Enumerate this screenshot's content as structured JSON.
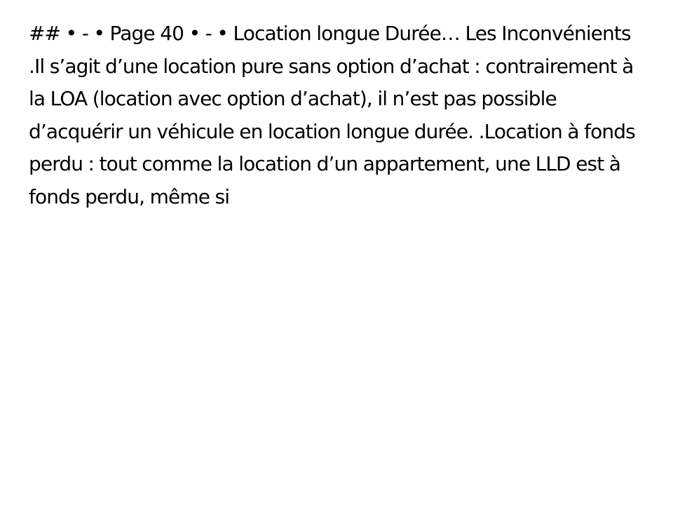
{
  "document": {
    "text": "## • - • Page 40 • - • Location longue Durée… Les Inconvénients .Il s’agit d’une location pure sans option d’achat : contrairement à la LOA (location avec option d’achat), il n’est pas possible d’acquérir un véhicule en location longue durée. .Location à fonds perdu : tout comme la location d’un appartement, une LLD est à fonds perdu, même si"
  }
}
